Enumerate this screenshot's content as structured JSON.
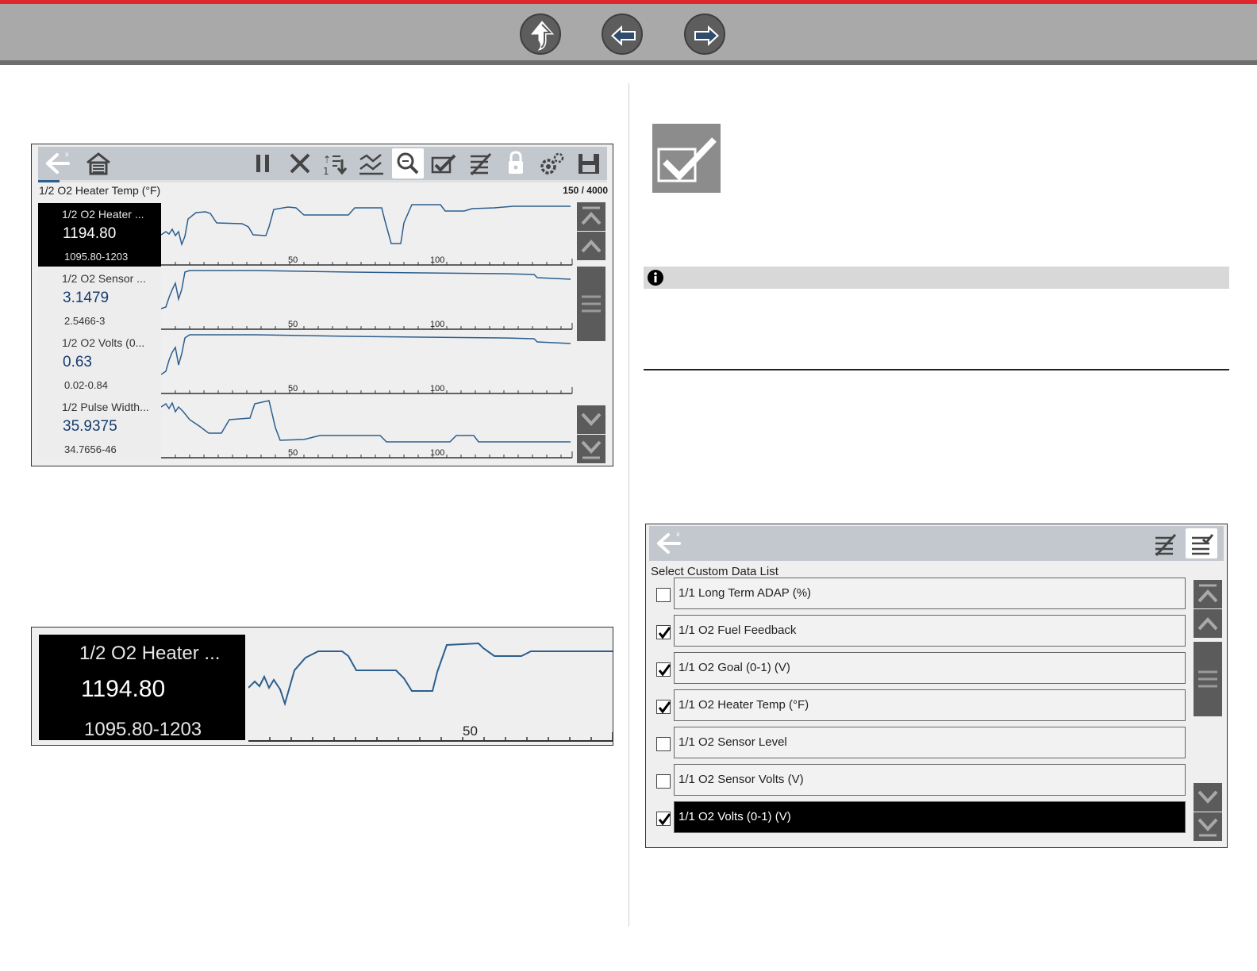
{
  "nav": {
    "up_icon": "up-arrow-icon",
    "back_icon": "left-arrow-icon",
    "forward_icon": "right-arrow-icon"
  },
  "screen1": {
    "toolbar_icons": [
      "back-icon",
      "home-icon",
      "pause-icon",
      "clear-icon",
      "previous-frame-icon",
      "graph-icon",
      "zoom-icon",
      "select-icon",
      "custom-list-icon",
      "lock-icon",
      "settings-icon",
      "save-icon"
    ],
    "title": "1/2 O2 Heater Temp (°F)",
    "frame_counter": "150 / 4000",
    "buffer_fraction": 0.0375,
    "parameters": [
      {
        "name": "1/2 O2 Heater ...",
        "value": "1194.80",
        "range": "1095.80-1203",
        "selected": true
      },
      {
        "name": "1/2 O2 Sensor ...",
        "value": "3.1479",
        "range": "2.5466-3",
        "selected": false
      },
      {
        "name": "1/2 O2 Volts (0...",
        "value": "0.63",
        "range": "0.02-0.84",
        "selected": false
      },
      {
        "name": "1/2 Pulse Width...",
        "value": "35.9375",
        "range": "34.7656-46",
        "selected": false
      }
    ],
    "axis_labels": [
      "50",
      "100"
    ]
  },
  "zoom": {
    "name": "1/2 O2 Heater ...",
    "value": "1194.80",
    "range": "1095.80-1203",
    "axis_label": "50"
  },
  "right": {
    "check_icon": "checkmark-icon",
    "info_icon": "info-icon"
  },
  "screen2": {
    "title": "Select Custom Data List",
    "items": [
      {
        "label": "1/1 Long Term ADAP (%)",
        "checked": false,
        "selected": false
      },
      {
        "label": "1/1 O2 Fuel Feedback",
        "checked": true,
        "selected": false
      },
      {
        "label": "1/1 O2 Goal (0-1) (V)",
        "checked": true,
        "selected": false
      },
      {
        "label": "1/1 O2 Heater Temp (°F)",
        "checked": true,
        "selected": false
      },
      {
        "label": "1/1 O2 Sensor Level",
        "checked": false,
        "selected": false
      },
      {
        "label": "1/1 O2 Sensor Volts (V)",
        "checked": false,
        "selected": false
      },
      {
        "label": "1/1 O2 Volts (0-1) (V)",
        "checked": true,
        "selected": true
      }
    ]
  },
  "colors": {
    "accent_red": "#e0262d",
    "header_gray": "#a9a9a9",
    "value_blue": "#163b6e",
    "toolbar": "#c3c8cf"
  }
}
